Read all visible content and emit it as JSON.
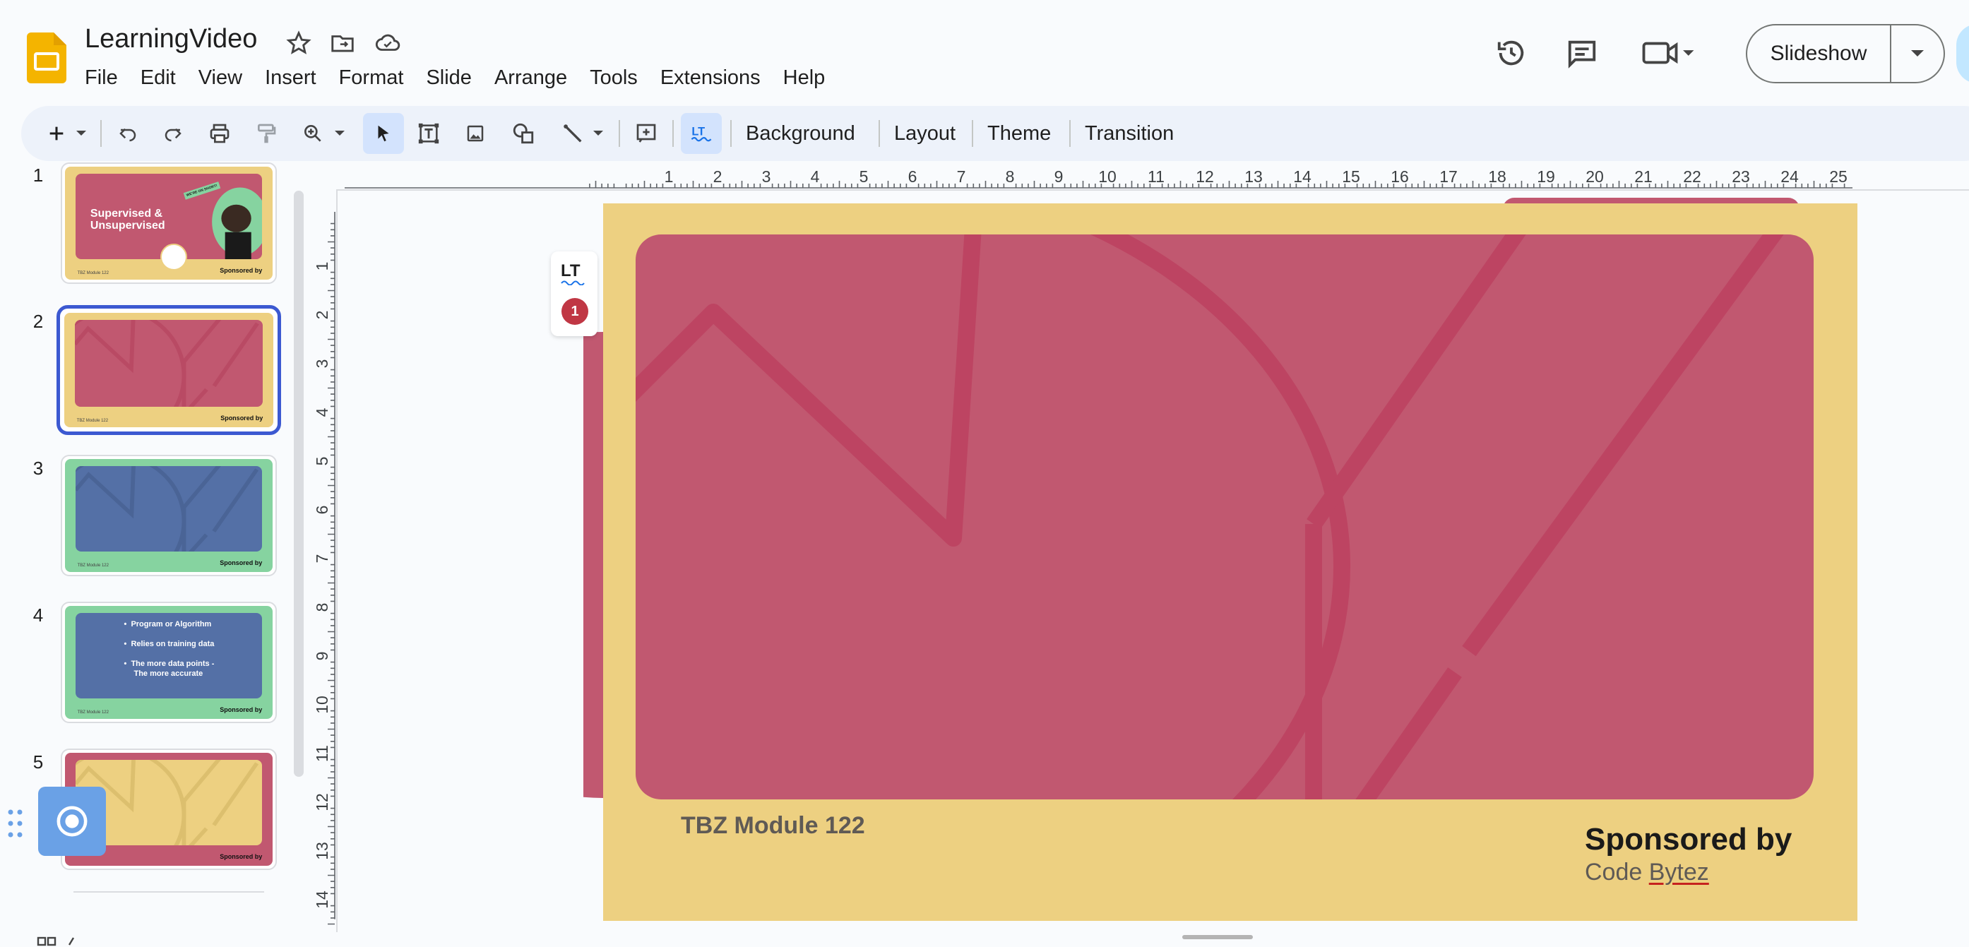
{
  "app": {
    "title": "LearningVideo",
    "menu": [
      "File",
      "Edit",
      "View",
      "Insert",
      "Format",
      "Slide",
      "Arrange",
      "Tools",
      "Extensions",
      "Help"
    ],
    "slideshow_label": "Slideshow"
  },
  "toolbar": {
    "background_label": "Background",
    "layout_label": "Layout",
    "theme_label": "Theme",
    "transition_label": "Transition"
  },
  "filmstrip": {
    "slides": [
      {
        "num": "1",
        "title_line1": "Supervised &",
        "title_line2": "Unsupervised",
        "tag": "WE'RE ON SHORT!",
        "footer_left": "TBZ Module 122",
        "footer_right": "Sponsored by"
      },
      {
        "num": "2",
        "footer_left": "TBZ Module 122",
        "footer_right": "Sponsored by"
      },
      {
        "num": "3",
        "footer_left": "TBZ Module 122",
        "footer_right": "Sponsored by"
      },
      {
        "num": "4",
        "bullet1": "Program or Algorithm",
        "bullet2": "Relies on training data",
        "bullet3": "The more data points -",
        "bullet3b": "The more accurate",
        "footer_left": "TBZ Module 122",
        "footer_right": "Sponsored by"
      },
      {
        "num": "5",
        "footer_right": "Sponsored by"
      }
    ]
  },
  "ruler": {
    "h_labels": [
      "1",
      "2",
      "3",
      "4",
      "5",
      "6",
      "7",
      "8",
      "9",
      "10",
      "11",
      "12",
      "13",
      "14",
      "15",
      "16",
      "17",
      "18",
      "19",
      "20",
      "21",
      "22",
      "23",
      "24",
      "25"
    ],
    "v_labels": [
      "1",
      "2",
      "3",
      "4",
      "5",
      "6",
      "7",
      "8",
      "9",
      "10",
      "11",
      "12",
      "13",
      "14"
    ]
  },
  "slide": {
    "footer_left": "TBZ Module 122",
    "sponsored_by": "Sponsored by",
    "sponsor_prefix": "Code ",
    "sponsor_name": "Bytez"
  },
  "languagetool": {
    "logo": "LT",
    "issue_count": "1"
  },
  "colors": {
    "slide_background": "#edd081",
    "card_pink": "#c15870",
    "card_blue": "#5470a6",
    "green": "#86d3a0",
    "accent_blue": "#3c59d1",
    "badge_red": "#c03744"
  }
}
